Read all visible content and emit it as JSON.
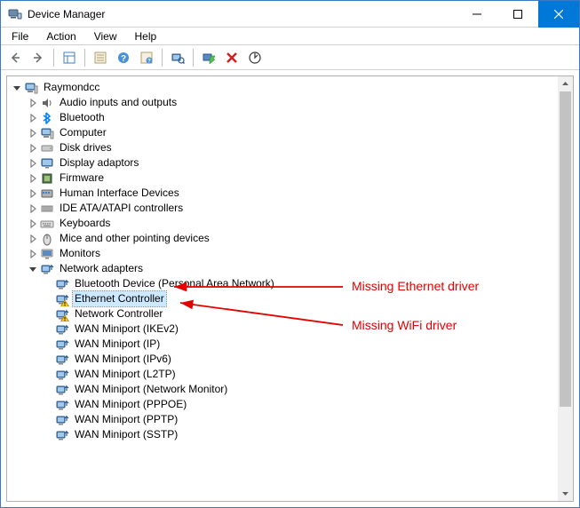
{
  "window": {
    "title": "Device Manager"
  },
  "menubar": {
    "file": "File",
    "action": "Action",
    "view": "View",
    "help": "Help"
  },
  "toolbar_icons": {
    "back": "back-arrow",
    "forward": "forward-arrow",
    "show_hidden": "show-hidden",
    "properties": "properties",
    "help": "help",
    "update": "update",
    "scan": "scan-for-changes",
    "enable": "enable",
    "uninstall": "uninstall",
    "add_legacy": "add-legacy"
  },
  "tree": {
    "root": {
      "label": "Raymondcc",
      "expanded": true,
      "icon": "computer"
    },
    "categories": [
      {
        "label": "Audio inputs and outputs",
        "icon": "audio",
        "expanded": false
      },
      {
        "label": "Bluetooth",
        "icon": "bluetooth",
        "expanded": false
      },
      {
        "label": "Computer",
        "icon": "computer",
        "expanded": false
      },
      {
        "label": "Disk drives",
        "icon": "disk",
        "expanded": false
      },
      {
        "label": "Display adaptors",
        "icon": "display",
        "expanded": false
      },
      {
        "label": "Firmware",
        "icon": "firmware",
        "expanded": false
      },
      {
        "label": "Human Interface Devices",
        "icon": "hid",
        "expanded": false
      },
      {
        "label": "IDE ATA/ATAPI controllers",
        "icon": "ide",
        "expanded": false
      },
      {
        "label": "Keyboards",
        "icon": "keyboard",
        "expanded": false
      },
      {
        "label": "Mice and other pointing devices",
        "icon": "mouse",
        "expanded": false
      },
      {
        "label": "Monitors",
        "icon": "monitor",
        "expanded": false
      },
      {
        "label": "Network adapters",
        "icon": "network",
        "expanded": true,
        "children": [
          {
            "label": "Bluetooth Device (Personal Area Network)",
            "icon": "network",
            "warning": false
          },
          {
            "label": "Ethernet Controller",
            "icon": "network",
            "warning": true,
            "selected": true
          },
          {
            "label": "Network Controller",
            "icon": "network",
            "warning": true
          },
          {
            "label": "WAN Miniport (IKEv2)",
            "icon": "network",
            "warning": false
          },
          {
            "label": "WAN Miniport (IP)",
            "icon": "network",
            "warning": false
          },
          {
            "label": "WAN Miniport (IPv6)",
            "icon": "network",
            "warning": false
          },
          {
            "label": "WAN Miniport (L2TP)",
            "icon": "network",
            "warning": false
          },
          {
            "label": "WAN Miniport (Network Monitor)",
            "icon": "network",
            "warning": false
          },
          {
            "label": "WAN Miniport (PPPOE)",
            "icon": "network",
            "warning": false
          },
          {
            "label": "WAN Miniport (PPTP)",
            "icon": "network",
            "warning": false
          },
          {
            "label": "WAN Miniport (SSTP)",
            "icon": "network",
            "warning": false
          }
        ]
      }
    ]
  },
  "annotations": {
    "ethernet": "Missing Ethernet driver",
    "wifi": "Missing WiFi driver"
  }
}
